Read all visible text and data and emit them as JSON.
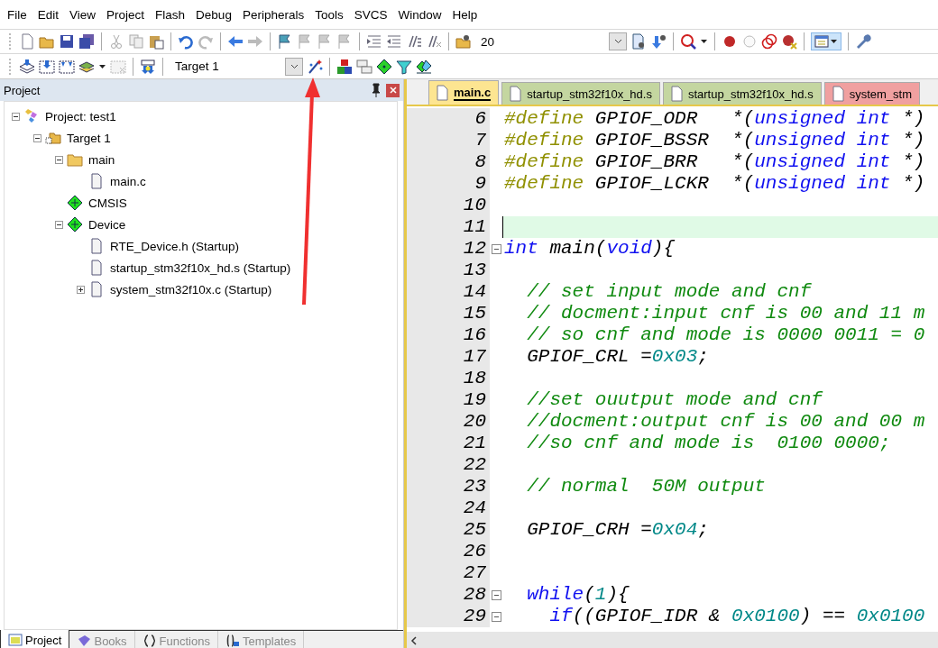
{
  "menu": [
    "File",
    "Edit",
    "View",
    "Project",
    "Flash",
    "Debug",
    "Peripherals",
    "Tools",
    "SVCS",
    "Window",
    "Help"
  ],
  "toolbar": {
    "find_value": "20",
    "target_value": "Target 1"
  },
  "project_panel": {
    "title": "Project",
    "tree": [
      {
        "kind": "project",
        "label": "Project: test1",
        "expanded": true,
        "children": [
          {
            "kind": "target",
            "label": "Target 1",
            "expanded": true,
            "children": [
              {
                "kind": "folder",
                "label": "main",
                "expanded": true,
                "children": [
                  {
                    "kind": "file",
                    "label": "main.c"
                  }
                ]
              },
              {
                "kind": "component",
                "label": "CMSIS"
              },
              {
                "kind": "component",
                "label": "Device",
                "expanded": true,
                "children": [
                  {
                    "kind": "file",
                    "label": "RTE_Device.h (Startup)"
                  },
                  {
                    "kind": "file",
                    "label": "startup_stm32f10x_hd.s (Startup)"
                  },
                  {
                    "kind": "file",
                    "label": "system_stm32f10x.c (Startup)",
                    "expanded": false
                  }
                ]
              }
            ]
          }
        ]
      }
    ],
    "tabs": [
      {
        "label": "Project",
        "selected": true
      },
      {
        "label": "Books",
        "selected": false
      },
      {
        "label": "Functions",
        "selected": false
      },
      {
        "label": "Templates",
        "selected": false
      }
    ]
  },
  "editor": {
    "tabs": [
      {
        "label": "main.c",
        "selected": true,
        "color": "#fde591"
      },
      {
        "label": "startup_stm32f10x_hd.s",
        "selected": false,
        "color": "#c4d6a0"
      },
      {
        "label": "startup_stm32f10x_hd.s",
        "selected": false,
        "color": "#c4d6a0"
      },
      {
        "label": "system_stm",
        "selected": false,
        "color": "#f0a0a0"
      }
    ],
    "lines": [
      {
        "number": "6",
        "current": false,
        "segments": [
          {
            "kind": "pp",
            "text": "#define"
          },
          {
            "kind": "plain",
            "text": " GPIOF_ODR   *("
          },
          {
            "kind": "kw",
            "text": "unsigned int"
          },
          {
            "kind": "plain",
            "text": " *)"
          }
        ]
      },
      {
        "number": "7",
        "current": false,
        "segments": [
          {
            "kind": "pp",
            "text": "#define"
          },
          {
            "kind": "plain",
            "text": " GPIOF_BSSR  *("
          },
          {
            "kind": "kw",
            "text": "unsigned int"
          },
          {
            "kind": "plain",
            "text": " *)"
          }
        ]
      },
      {
        "number": "8",
        "current": false,
        "segments": [
          {
            "kind": "pp",
            "text": "#define"
          },
          {
            "kind": "plain",
            "text": " GPIOF_BRR   *("
          },
          {
            "kind": "kw",
            "text": "unsigned int"
          },
          {
            "kind": "plain",
            "text": " *)"
          }
        ]
      },
      {
        "number": "9",
        "current": false,
        "segments": [
          {
            "kind": "pp",
            "text": "#define"
          },
          {
            "kind": "plain",
            "text": " GPIOF_LCKR  *("
          },
          {
            "kind": "kw",
            "text": "unsigned int"
          },
          {
            "kind": "plain",
            "text": " *)"
          }
        ]
      },
      {
        "number": "10",
        "current": false
      },
      {
        "number": "11",
        "current": true
      },
      {
        "number": "12",
        "current": false,
        "expanded": true,
        "segments": [
          {
            "kind": "kw",
            "text": "int"
          },
          {
            "kind": "plain",
            "text": " main("
          },
          {
            "kind": "kw",
            "text": "void"
          },
          {
            "kind": "plain",
            "text": "){"
          }
        ]
      },
      {
        "number": "13",
        "current": false
      },
      {
        "number": "14",
        "current": false,
        "segments": [
          {
            "kind": "cm",
            "text": "  // set input mode and cnf"
          }
        ]
      },
      {
        "number": "15",
        "current": false,
        "segments": [
          {
            "kind": "cm",
            "text": "  // docment:input cnf is 00 and 11 m"
          }
        ]
      },
      {
        "number": "16",
        "current": false,
        "segments": [
          {
            "kind": "cm",
            "text": "  // so cnf and mode is 0000 0011 = 0"
          }
        ]
      },
      {
        "number": "17",
        "current": false,
        "segments": [
          {
            "kind": "plain",
            "text": "  GPIOF_CRL ="
          },
          {
            "kind": "num",
            "text": "0x03"
          },
          {
            "kind": "plain",
            "text": ";"
          }
        ]
      },
      {
        "number": "18",
        "current": false
      },
      {
        "number": "19",
        "current": false,
        "segments": [
          {
            "kind": "cm",
            "text": "  //set ouutput mode and cnf"
          }
        ]
      },
      {
        "number": "20",
        "current": false,
        "segments": [
          {
            "kind": "cm",
            "text": "  //docment:output cnf is 00 and 00 m"
          }
        ]
      },
      {
        "number": "21",
        "current": false,
        "segments": [
          {
            "kind": "cm",
            "text": "  //so cnf and mode is  0100 0000;"
          }
        ]
      },
      {
        "number": "22",
        "current": false
      },
      {
        "number": "23",
        "current": false,
        "segments": [
          {
            "kind": "cm",
            "text": "  // normal  50M output"
          }
        ]
      },
      {
        "number": "24",
        "current": false
      },
      {
        "number": "25",
        "current": false,
        "segments": [
          {
            "kind": "plain",
            "text": "  GPIOF_CRH ="
          },
          {
            "kind": "num",
            "text": "0x04"
          },
          {
            "kind": "plain",
            "text": ";"
          }
        ]
      },
      {
        "number": "26",
        "current": false
      },
      {
        "number": "27",
        "current": false
      },
      {
        "number": "28",
        "current": false,
        "expanded": true,
        "segments": [
          {
            "kind": "kw",
            "text": "  while"
          },
          {
            "kind": "plain",
            "text": "("
          },
          {
            "kind": "num",
            "text": "1"
          },
          {
            "kind": "plain",
            "text": "){"
          }
        ]
      },
      {
        "number": "29",
        "current": false,
        "expanded": true,
        "segments": [
          {
            "kind": "kw",
            "text": "    if"
          },
          {
            "kind": "plain",
            "text": "((GPIOF_IDR & "
          },
          {
            "kind": "num",
            "text": "0x0100"
          },
          {
            "kind": "plain",
            "text": ") == "
          },
          {
            "kind": "num",
            "text": "0x0100"
          }
        ]
      }
    ]
  }
}
